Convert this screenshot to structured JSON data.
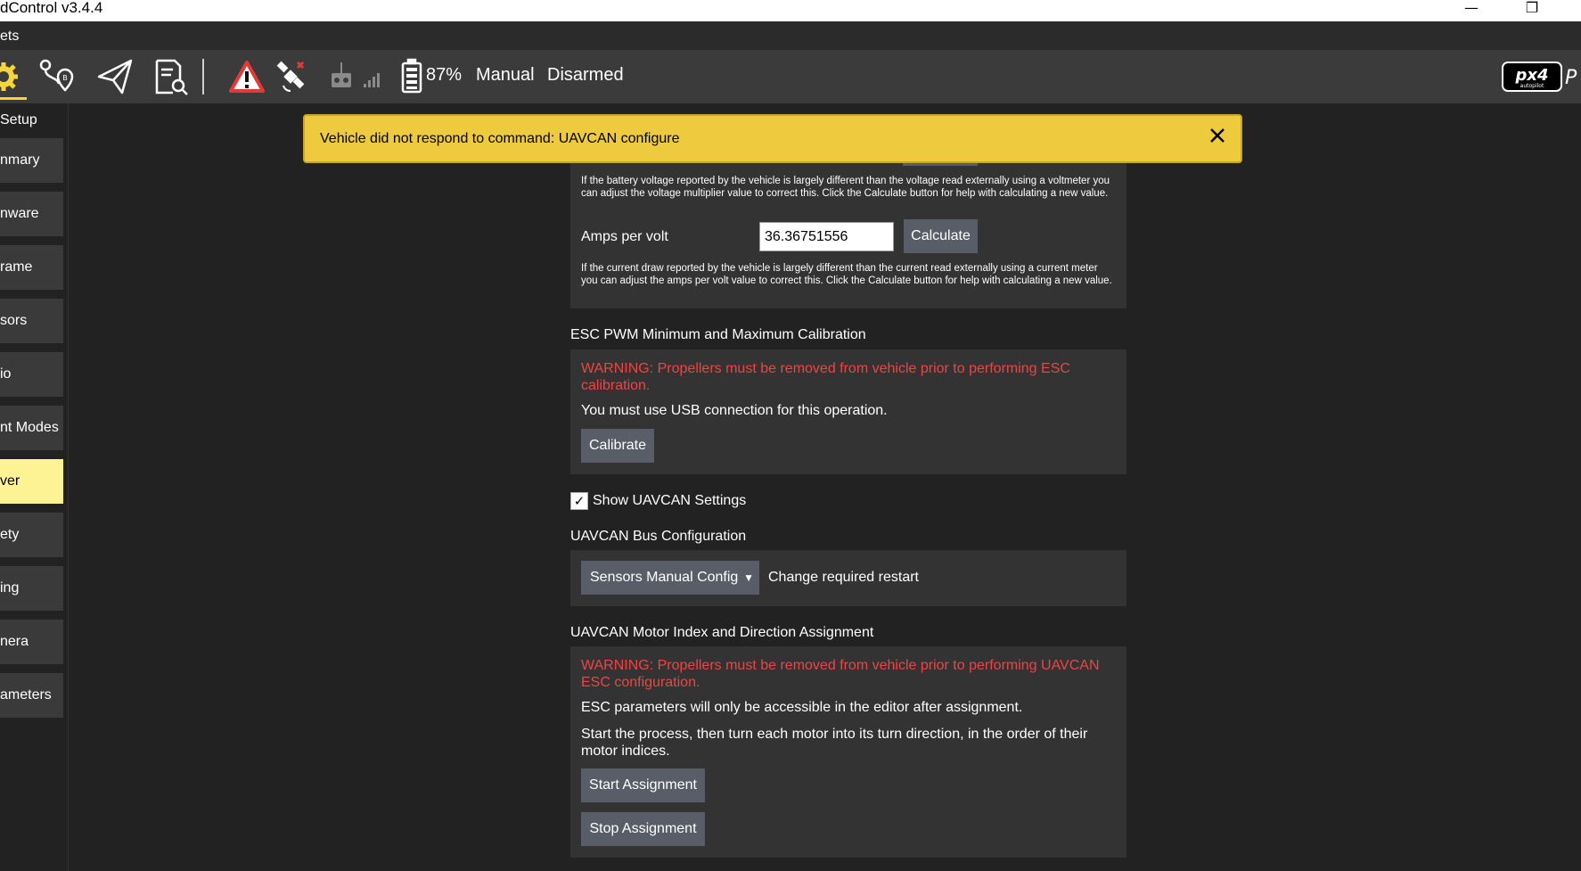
{
  "window": {
    "title": "dControl v3.4.4",
    "minimize_glyph": "—",
    "restore_glyph": "❐"
  },
  "menu": {
    "label": "ets"
  },
  "toolbar": {
    "battery_percent": "87%",
    "flight_mode": "Manual",
    "arm_status": "Disarmed",
    "icons": [
      "gear-icon",
      "plan-route-icon",
      "fly-paper-plane-icon",
      "analyze-document-icon",
      "warning-icon",
      "satellite-icon",
      "rc-transmitter-icon",
      "signal-bars-icon",
      "battery-icon",
      "px4-logo"
    ],
    "colors": {
      "active_accent": "#f5d53b",
      "warning_red": "#e53935"
    }
  },
  "sidebar": {
    "title": "Setup",
    "items": [
      {
        "label": "nmary"
      },
      {
        "label": "nware"
      },
      {
        "label": "rame"
      },
      {
        "label": "sors"
      },
      {
        "label": "io"
      },
      {
        "label": "nt Modes"
      },
      {
        "label": "ver",
        "active": true
      },
      {
        "label": "ety"
      },
      {
        "label": "ing"
      },
      {
        "label": "nera"
      },
      {
        "label": "ameters"
      }
    ]
  },
  "notification": {
    "message": "Vehicle did not respond to command: UAVCAN configure",
    "close_glyph": "✕",
    "color": "#eeca3e"
  },
  "power": {
    "voltage_help": "If the battery voltage reported by the vehicle is largely different than the voltage read externally using a voltmeter you can adjust the voltage multiplier value to correct this. Click the Calculate button for help with calculating a new value.",
    "amps_label": "Amps per volt",
    "amps_value": "36.36751556",
    "calculate_label": "Calculate",
    "amps_help": "If the current draw reported by the vehicle is largely different than the current read externally using a current meter you can adjust the amps per volt value to correct this. Click the Calculate button for help with calculating a new value."
  },
  "esc_calibration": {
    "title": "ESC PWM Minimum and Maximum Calibration",
    "warning": "WARNING: Propellers must be removed from vehicle prior to performing ESC calibration.",
    "usb_note": "You must use USB connection for this operation.",
    "calibrate_label": "Calibrate"
  },
  "uavcan_toggle": {
    "label": "Show UAVCAN Settings",
    "checked_glyph": "✓"
  },
  "uavcan_bus": {
    "title": "UAVCAN Bus Configuration",
    "selected": "Sensors Manual Config",
    "caret": "▼",
    "note": "Change required restart"
  },
  "uavcan_motor": {
    "title": "UAVCAN Motor Index and Direction Assignment",
    "warning": "WARNING: Propellers must be removed from vehicle prior to performing UAVCAN ESC configuration.",
    "note1": "ESC parameters will only be accessible in the editor after assignment.",
    "note2": "Start the process, then turn each motor into its turn direction, in the order of their motor indices.",
    "start_label": "Start Assignment",
    "stop_label": "Stop Assignment"
  }
}
